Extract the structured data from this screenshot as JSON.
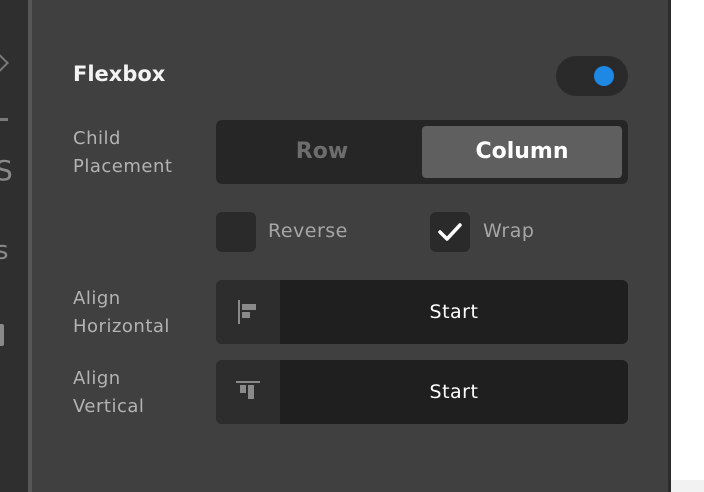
{
  "panel": {
    "title": "Flexbox",
    "toggle_on": true
  },
  "child_placement": {
    "label_line1": "Child",
    "label_line2": "Placement",
    "options": [
      "Row",
      "Column"
    ],
    "selected": "Column"
  },
  "checkboxes": {
    "reverse": {
      "label": "Reverse",
      "checked": false
    },
    "wrap": {
      "label": "Wrap",
      "checked": true
    }
  },
  "align_horizontal": {
    "label_line1": "Align",
    "label_line2": "Horizontal",
    "value": "Start",
    "icon": "align-horizontal-start-icon"
  },
  "align_vertical": {
    "label_line1": "Align",
    "label_line2": "Vertical",
    "value": "Start",
    "icon": "align-vertical-start-icon"
  },
  "left_strip_fragments": [
    "S",
    "s"
  ],
  "colors": {
    "panel_bg": "#404040",
    "toggle_accent": "#1e88e5",
    "selected_segment": "#5f5f5f"
  }
}
